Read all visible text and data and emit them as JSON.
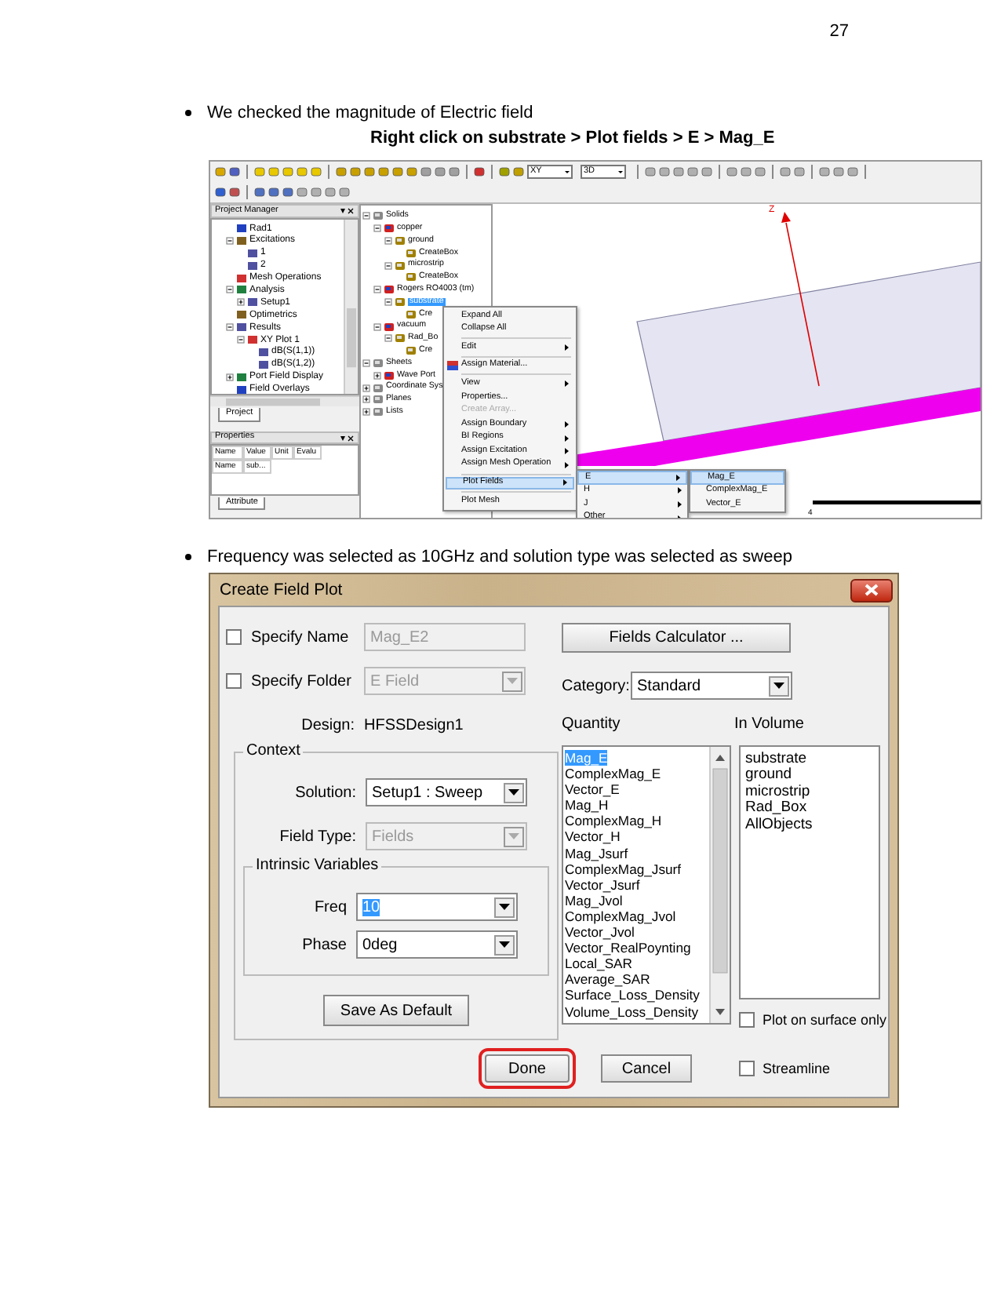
{
  "page_number": "27",
  "note_1": {
    "text": "We checked the magnitude of Electric field"
  },
  "caption": "Right click on substrate > Plot fields > E > Mag_E",
  "hfss_window": {
    "toolbar": {
      "dropdowns": [
        {
          "value": "XY"
        },
        {
          "value": "3D"
        }
      ]
    },
    "project_manager": {
      "title": "Project Manager",
      "tab": "Project",
      "tree": [
        {
          "label": "Rad1"
        },
        {
          "label": "Excitations",
          "expanded": true,
          "children": [
            {
              "label": "1"
            },
            {
              "label": "2"
            }
          ]
        },
        {
          "label": "Mesh Operations"
        },
        {
          "label": "Analysis",
          "expanded": true,
          "children": [
            {
              "label": "Setup1",
              "expanded": false
            }
          ]
        },
        {
          "label": "Optimetrics"
        },
        {
          "label": "Results",
          "expanded": true,
          "children": [
            {
              "label": "XY Plot 1",
              "expanded": true,
              "children": [
                {
                  "label": "dB(S(1,1))"
                },
                {
                  "label": "dB(S(1,2))"
                }
              ]
            }
          ]
        },
        {
          "label": "Port Field Display",
          "expanded": false
        },
        {
          "label": "Field Overlays"
        }
      ]
    },
    "properties": {
      "title": "Properties",
      "tab": "Attribute",
      "columns": [
        "Name",
        "Value",
        "Unit",
        "Evalu"
      ],
      "rows": [
        [
          "Name",
          "sub..."
        ]
      ]
    },
    "model_tree": [
      {
        "label": "Solids",
        "selected": false,
        "expanded": true,
        "children": [
          {
            "label": "copper",
            "selected": false,
            "expanded": true,
            "children": [
              {
                "label": "ground",
                "selected": false,
                "expanded": true,
                "children": [
                  {
                    "label": "CreateBox",
                    "selected": false
                  }
                ]
              },
              {
                "label": "microstrip",
                "selected": false,
                "expanded": true,
                "children": [
                  {
                    "label": "CreateBox",
                    "selected": false
                  }
                ]
              }
            ]
          },
          {
            "label": "Rogers RO4003 (tm)",
            "selected": false,
            "expanded": true,
            "children": [
              {
                "label": "substrate",
                "selected": true,
                "expanded": true,
                "children": [
                  {
                    "label": "Cre",
                    "selected": false
                  }
                ]
              }
            ]
          },
          {
            "label": "vacuum",
            "selected": false,
            "expanded": true,
            "children": [
              {
                "label": "Rad_Bo",
                "selected": false,
                "expanded": true,
                "children": [
                  {
                    "label": "Cre",
                    "selected": false
                  }
                ]
              }
            ]
          }
        ]
      },
      {
        "label": "Sheets",
        "selected": false,
        "expanded": true,
        "children": [
          {
            "label": "Wave Port",
            "selected": false,
            "expanded": false
          }
        ]
      },
      {
        "label": "Coordinate Sys",
        "selected": false,
        "expanded": false
      },
      {
        "label": "Planes",
        "selected": false,
        "expanded": false
      },
      {
        "label": "Lists",
        "selected": false,
        "expanded": false
      }
    ],
    "view": {
      "axis_label": "Z",
      "scale_label": "4"
    },
    "context_menu": [
      {
        "kind": "item",
        "label": "Expand All",
        "submenu": false,
        "disabled": false,
        "selected": false
      },
      {
        "kind": "item",
        "label": "Collapse All",
        "submenu": false,
        "disabled": false,
        "selected": false
      },
      {
        "kind": "separator"
      },
      {
        "kind": "item",
        "label": "Edit",
        "submenu": true,
        "disabled": false,
        "selected": false
      },
      {
        "kind": "separator"
      },
      {
        "kind": "item",
        "label": "Assign Material...",
        "submenu": false,
        "disabled": false,
        "selected": false
      },
      {
        "kind": "separator"
      },
      {
        "kind": "item",
        "label": "View",
        "submenu": true,
        "disabled": false,
        "selected": false
      },
      {
        "kind": "item",
        "label": "Properties...",
        "submenu": false,
        "disabled": false,
        "selected": false
      },
      {
        "kind": "item",
        "label": "Create Array...",
        "submenu": false,
        "disabled": true,
        "selected": false
      },
      {
        "kind": "item",
        "label": "Assign Boundary",
        "submenu": true,
        "disabled": false,
        "selected": false
      },
      {
        "kind": "item",
        "label": "BI Regions",
        "submenu": true,
        "disabled": false,
        "selected": false
      },
      {
        "kind": "item",
        "label": "Assign Excitation",
        "submenu": true,
        "disabled": false,
        "selected": false
      },
      {
        "kind": "item",
        "label": "Assign Mesh Operation",
        "submenu": true,
        "disabled": false,
        "selected": false
      },
      {
        "kind": "separator"
      },
      {
        "kind": "item",
        "label": "Plot Fields",
        "submenu": true,
        "disabled": false,
        "selected": true
      },
      {
        "kind": "separator"
      },
      {
        "kind": "item",
        "label": "Plot Mesh",
        "submenu": false,
        "disabled": false,
        "selected": false
      }
    ],
    "plot_fields_submenu": [
      {
        "label": "E",
        "submenu": true,
        "selected": true
      },
      {
        "label": "H",
        "submenu": true,
        "selected": false
      },
      {
        "label": "J",
        "submenu": true,
        "selected": false
      },
      {
        "label": "Other",
        "submenu": true,
        "selected": false
      }
    ],
    "e_submenu": [
      {
        "label": "Mag_E",
        "selected": true
      },
      {
        "label": "ComplexMag_E",
        "selected": false
      },
      {
        "label": "Vector_E",
        "selected": false
      }
    ]
  },
  "note_2": {
    "text": "Frequency was selected as 10GHz and solution type was selected as sweep"
  },
  "dialog": {
    "title": "Create Field Plot",
    "specify_name": {
      "label": "Specify Name",
      "checked": false,
      "value": "Mag_E2",
      "disabled": true
    },
    "specify_folder": {
      "label": "Specify Folder",
      "checked": false,
      "value": "E Field",
      "disabled": true
    },
    "design": {
      "label": "Design:",
      "value": "HFSSDesign1"
    },
    "context": {
      "title": "Context",
      "solution": {
        "label": "Solution:",
        "value": "Setup1 : Sweep",
        "disabled": false
      },
      "field_type": {
        "label": "Field Type:",
        "value": "Fields",
        "disabled": true
      },
      "intrinsic_variables": {
        "title": "Intrinsic Variables",
        "freq": {
          "label": "Freq",
          "value": "10",
          "highlighted": true
        },
        "phase": {
          "label": "Phase",
          "value": "0deg",
          "highlighted": false
        }
      },
      "save_button": "Save As Default"
    },
    "fields_calculator_button": "Fields Calculator ...",
    "category": {
      "label": "Category:",
      "value": "Standard"
    },
    "quantity": {
      "label": "Quantity",
      "items": [
        {
          "label": "Mag_E",
          "selected": true
        },
        {
          "label": "ComplexMag_E",
          "selected": false
        },
        {
          "label": "Vector_E",
          "selected": false
        },
        {
          "label": "Mag_H",
          "selected": false
        },
        {
          "label": "ComplexMag_H",
          "selected": false
        },
        {
          "label": "Vector_H",
          "selected": false
        },
        {
          "label": "Mag_Jsurf",
          "selected": false
        },
        {
          "label": "ComplexMag_Jsurf",
          "selected": false
        },
        {
          "label": "Vector_Jsurf",
          "selected": false
        },
        {
          "label": "Mag_Jvol",
          "selected": false
        },
        {
          "label": "ComplexMag_Jvol",
          "selected": false
        },
        {
          "label": "Vector_Jvol",
          "selected": false
        },
        {
          "label": "Vector_RealPoynting",
          "selected": false
        },
        {
          "label": "Local_SAR",
          "selected": false
        },
        {
          "label": "Average_SAR",
          "selected": false
        },
        {
          "label": "Surface_Loss_Density",
          "selected": false
        },
        {
          "label": "Volume_Loss_Density",
          "selected": false
        }
      ]
    },
    "in_volume": {
      "label": "In Volume",
      "items": [
        {
          "label": "substrate",
          "selected": false
        },
        {
          "label": "ground",
          "selected": false
        },
        {
          "label": "microstrip",
          "selected": false
        },
        {
          "label": "Rad_Box",
          "selected": false
        },
        {
          "label": "AllObjects",
          "selected": false
        }
      ]
    },
    "plot_on_surface_only": {
      "label": "Plot on surface only",
      "checked": false
    },
    "streamline": {
      "label": "Streamline",
      "checked": false
    },
    "buttons": [
      {
        "label": "Done",
        "annotated": true
      },
      {
        "label": "Cancel",
        "annotated": false
      }
    ]
  }
}
